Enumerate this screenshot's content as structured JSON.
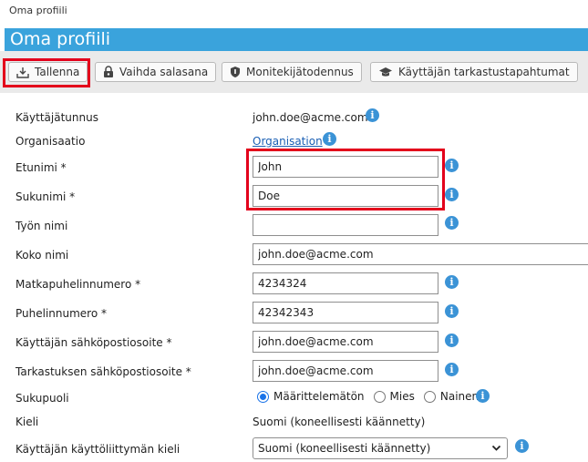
{
  "breadcrumb": "Oma profiili",
  "page_title": "Oma profiili",
  "toolbar": {
    "save": "Tallenna",
    "change_password": "Vaihda salasana",
    "mfa": "Monitekijätodennus",
    "audit": "Käyttäjän tarkastustapahtumat"
  },
  "fields": {
    "username": {
      "label": "Käyttäjätunnus",
      "value": "john.doe@acme.com"
    },
    "organisation": {
      "label": "Organisaatio",
      "value": "Organisation"
    },
    "first_name": {
      "label": "Etunimi *",
      "value": "John"
    },
    "last_name": {
      "label": "Sukunimi *",
      "value": "Doe"
    },
    "job_title": {
      "label": "Työn nimi",
      "value": ""
    },
    "full_name": {
      "label": "Koko nimi",
      "value": "john.doe@acme.com"
    },
    "mobile": {
      "label": "Matkapuhelinnumero *",
      "value": "4234324"
    },
    "phone": {
      "label": "Puhelinnumero *",
      "value": "42342343"
    },
    "user_email": {
      "label": "Käyttäjän sähköpostiosoite *",
      "value": "john.doe@acme.com"
    },
    "audit_email": {
      "label": "Tarkastuksen sähköpostiosoite *",
      "value": "john.doe@acme.com"
    },
    "gender": {
      "label": "Sukupuoli",
      "options": [
        "Määrittelemätön",
        "Mies",
        "Nainen"
      ],
      "selected": "Määrittelemätön"
    },
    "language": {
      "label": "Kieli",
      "value": "Suomi (koneellisesti käännetty)"
    },
    "ui_language": {
      "label": "Käyttäjän käyttöliittymän kieli",
      "value": "Suomi (koneellisesti käännetty)"
    }
  },
  "icons": {
    "info": "info-icon",
    "save": "download-icon",
    "password": "lock-icon",
    "mfa": "shield-icon",
    "audit": "graduation-cap-icon"
  },
  "colors": {
    "title_bar": "#3aa3dc",
    "highlight": "#e3001b",
    "info": "#3b93d6",
    "link": "#1a5fb4"
  }
}
